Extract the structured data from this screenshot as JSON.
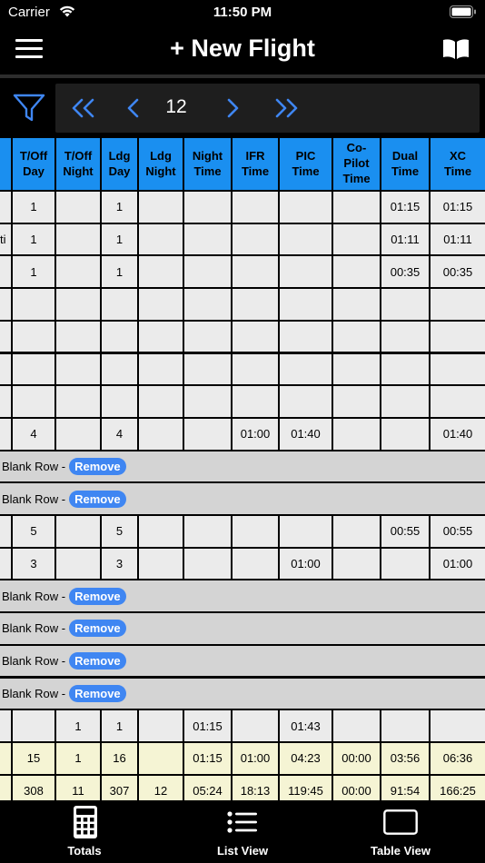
{
  "status": {
    "carrier": "Carrier",
    "time": "11:50 PM"
  },
  "nav": {
    "title": "+ New Flight"
  },
  "pager": {
    "page": "12"
  },
  "columns": [
    [
      "T/Off",
      "Day"
    ],
    [
      "T/Off",
      "Night"
    ],
    [
      "Ldg",
      "Day"
    ],
    [
      "Ldg",
      "Night"
    ],
    [
      "Night",
      "Time"
    ],
    [
      "IFR",
      "Time"
    ],
    [
      "PIC",
      "Time"
    ],
    [
      "Co-",
      "Pilot",
      "Time"
    ],
    [
      "Dual",
      "Time"
    ],
    [
      "XC",
      "Time"
    ]
  ],
  "rows": [
    {
      "type": "data",
      "prefix": "",
      "cells": [
        "1",
        "",
        "1",
        "",
        "",
        "",
        "",
        "",
        "01:15",
        "01:15"
      ]
    },
    {
      "type": "data",
      "prefix": "ti",
      "cells": [
        "1",
        "",
        "1",
        "",
        "",
        "",
        "",
        "",
        "01:11",
        "01:11"
      ]
    },
    {
      "type": "data",
      "prefix": "",
      "cells": [
        "1",
        "",
        "1",
        "",
        "",
        "",
        "",
        "",
        "00:35",
        "00:35"
      ]
    },
    {
      "type": "data",
      "prefix": "",
      "cells": [
        "",
        "",
        "",
        "",
        "",
        "",
        "",
        "",
        "",
        ""
      ]
    },
    {
      "type": "data",
      "prefix": "",
      "cells": [
        "",
        "",
        "",
        "",
        "",
        "",
        "",
        "",
        "",
        ""
      ]
    },
    {
      "type": "data",
      "prefix": "",
      "cells": [
        "",
        "",
        "",
        "",
        "",
        "",
        "",
        "",
        "",
        ""
      ]
    },
    {
      "type": "data",
      "prefix": "",
      "cells": [
        "",
        "",
        "",
        "",
        "",
        "",
        "",
        "",
        "",
        ""
      ]
    },
    {
      "type": "data",
      "prefix": "",
      "cells": [
        "4",
        "",
        "4",
        "",
        "",
        "01:00",
        "01:40",
        "",
        "",
        "01:40"
      ]
    },
    {
      "type": "blank",
      "label": "Blank Row -",
      "button": "Remove"
    },
    {
      "type": "blank",
      "label": "Blank Row -",
      "button": "Remove"
    },
    {
      "type": "data",
      "prefix": "",
      "cells": [
        "5",
        "",
        "5",
        "",
        "",
        "",
        "",
        "",
        "00:55",
        "00:55"
      ]
    },
    {
      "type": "data",
      "prefix": "",
      "cells": [
        "3",
        "",
        "3",
        "",
        "",
        "",
        "01:00",
        "",
        "",
        "01:00"
      ]
    },
    {
      "type": "blank",
      "label": "Blank Row -",
      "button": "Remove"
    },
    {
      "type": "blank",
      "label": "Blank Row -",
      "button": "Remove"
    },
    {
      "type": "blank",
      "label": "Blank Row -",
      "button": "Remove"
    },
    {
      "type": "blank",
      "label": "Blank Row -",
      "button": "Remove"
    },
    {
      "type": "data",
      "prefix": "",
      "cells": [
        "",
        "1",
        "1",
        "",
        "01:15",
        "",
        "01:43",
        "",
        "",
        ""
      ]
    },
    {
      "type": "total",
      "prefix": "",
      "cells": [
        "15",
        "1",
        "16",
        "",
        "01:15",
        "01:00",
        "04:23",
        "00:00",
        "03:56",
        "06:36"
      ]
    },
    {
      "type": "total",
      "prefix": "",
      "cells": [
        "308",
        "11",
        "307",
        "12",
        "05:24",
        "18:13",
        "119:45",
        "00:00",
        "91:54",
        "166:25"
      ]
    }
  ],
  "tabs": [
    {
      "label": "Totals",
      "icon": "calculator-icon"
    },
    {
      "label": "List View",
      "icon": "list-icon"
    },
    {
      "label": "Table View",
      "icon": "table-view-icon"
    }
  ],
  "colors": {
    "header": "#1a8ff0",
    "accent": "#3f86f2",
    "cell": "#ebebeb",
    "blank": "#d4d4d4",
    "total": "#f5f4d4"
  }
}
